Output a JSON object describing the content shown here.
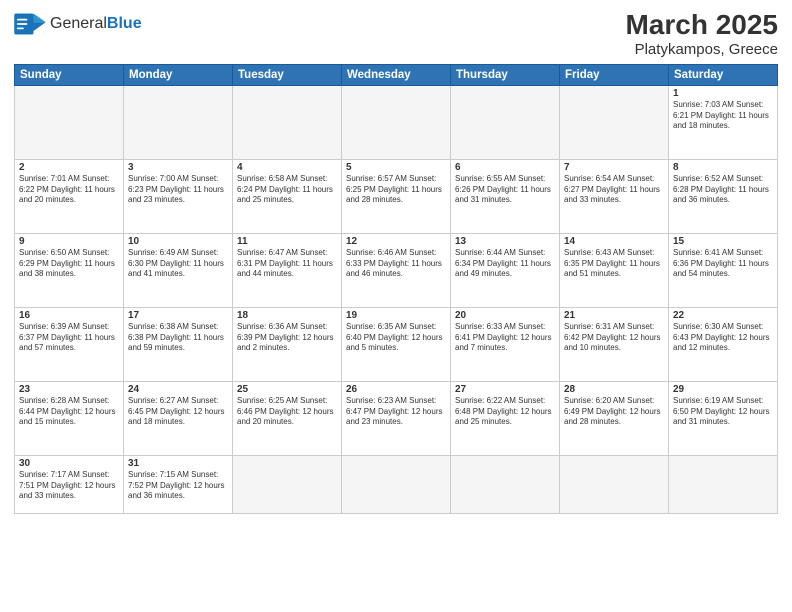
{
  "header": {
    "logo_text_normal": "General",
    "logo_text_bold": "Blue",
    "title": "March 2025",
    "subtitle": "Platykampos, Greece"
  },
  "days_of_week": [
    "Sunday",
    "Monday",
    "Tuesday",
    "Wednesday",
    "Thursday",
    "Friday",
    "Saturday"
  ],
  "weeks": [
    [
      {
        "day": "",
        "info": ""
      },
      {
        "day": "",
        "info": ""
      },
      {
        "day": "",
        "info": ""
      },
      {
        "day": "",
        "info": ""
      },
      {
        "day": "",
        "info": ""
      },
      {
        "day": "",
        "info": ""
      },
      {
        "day": "1",
        "info": "Sunrise: 7:03 AM\nSunset: 6:21 PM\nDaylight: 11 hours\nand 18 minutes."
      }
    ],
    [
      {
        "day": "2",
        "info": "Sunrise: 7:01 AM\nSunset: 6:22 PM\nDaylight: 11 hours\nand 20 minutes."
      },
      {
        "day": "3",
        "info": "Sunrise: 7:00 AM\nSunset: 6:23 PM\nDaylight: 11 hours\nand 23 minutes."
      },
      {
        "day": "4",
        "info": "Sunrise: 6:58 AM\nSunset: 6:24 PM\nDaylight: 11 hours\nand 25 minutes."
      },
      {
        "day": "5",
        "info": "Sunrise: 6:57 AM\nSunset: 6:25 PM\nDaylight: 11 hours\nand 28 minutes."
      },
      {
        "day": "6",
        "info": "Sunrise: 6:55 AM\nSunset: 6:26 PM\nDaylight: 11 hours\nand 31 minutes."
      },
      {
        "day": "7",
        "info": "Sunrise: 6:54 AM\nSunset: 6:27 PM\nDaylight: 11 hours\nand 33 minutes."
      },
      {
        "day": "8",
        "info": "Sunrise: 6:52 AM\nSunset: 6:28 PM\nDaylight: 11 hours\nand 36 minutes."
      }
    ],
    [
      {
        "day": "9",
        "info": "Sunrise: 6:50 AM\nSunset: 6:29 PM\nDaylight: 11 hours\nand 38 minutes."
      },
      {
        "day": "10",
        "info": "Sunrise: 6:49 AM\nSunset: 6:30 PM\nDaylight: 11 hours\nand 41 minutes."
      },
      {
        "day": "11",
        "info": "Sunrise: 6:47 AM\nSunset: 6:31 PM\nDaylight: 11 hours\nand 44 minutes."
      },
      {
        "day": "12",
        "info": "Sunrise: 6:46 AM\nSunset: 6:33 PM\nDaylight: 11 hours\nand 46 minutes."
      },
      {
        "day": "13",
        "info": "Sunrise: 6:44 AM\nSunset: 6:34 PM\nDaylight: 11 hours\nand 49 minutes."
      },
      {
        "day": "14",
        "info": "Sunrise: 6:43 AM\nSunset: 6:35 PM\nDaylight: 11 hours\nand 51 minutes."
      },
      {
        "day": "15",
        "info": "Sunrise: 6:41 AM\nSunset: 6:36 PM\nDaylight: 11 hours\nand 54 minutes."
      }
    ],
    [
      {
        "day": "16",
        "info": "Sunrise: 6:39 AM\nSunset: 6:37 PM\nDaylight: 11 hours\nand 57 minutes."
      },
      {
        "day": "17",
        "info": "Sunrise: 6:38 AM\nSunset: 6:38 PM\nDaylight: 11 hours\nand 59 minutes."
      },
      {
        "day": "18",
        "info": "Sunrise: 6:36 AM\nSunset: 6:39 PM\nDaylight: 12 hours\nand 2 minutes."
      },
      {
        "day": "19",
        "info": "Sunrise: 6:35 AM\nSunset: 6:40 PM\nDaylight: 12 hours\nand 5 minutes."
      },
      {
        "day": "20",
        "info": "Sunrise: 6:33 AM\nSunset: 6:41 PM\nDaylight: 12 hours\nand 7 minutes."
      },
      {
        "day": "21",
        "info": "Sunrise: 6:31 AM\nSunset: 6:42 PM\nDaylight: 12 hours\nand 10 minutes."
      },
      {
        "day": "22",
        "info": "Sunrise: 6:30 AM\nSunset: 6:43 PM\nDaylight: 12 hours\nand 12 minutes."
      }
    ],
    [
      {
        "day": "23",
        "info": "Sunrise: 6:28 AM\nSunset: 6:44 PM\nDaylight: 12 hours\nand 15 minutes."
      },
      {
        "day": "24",
        "info": "Sunrise: 6:27 AM\nSunset: 6:45 PM\nDaylight: 12 hours\nand 18 minutes."
      },
      {
        "day": "25",
        "info": "Sunrise: 6:25 AM\nSunset: 6:46 PM\nDaylight: 12 hours\nand 20 minutes."
      },
      {
        "day": "26",
        "info": "Sunrise: 6:23 AM\nSunset: 6:47 PM\nDaylight: 12 hours\nand 23 minutes."
      },
      {
        "day": "27",
        "info": "Sunrise: 6:22 AM\nSunset: 6:48 PM\nDaylight: 12 hours\nand 25 minutes."
      },
      {
        "day": "28",
        "info": "Sunrise: 6:20 AM\nSunset: 6:49 PM\nDaylight: 12 hours\nand 28 minutes."
      },
      {
        "day": "29",
        "info": "Sunrise: 6:19 AM\nSunset: 6:50 PM\nDaylight: 12 hours\nand 31 minutes."
      }
    ],
    [
      {
        "day": "30",
        "info": "Sunrise: 7:17 AM\nSunset: 7:51 PM\nDaylight: 12 hours\nand 33 minutes."
      },
      {
        "day": "31",
        "info": "Sunrise: 7:15 AM\nSunset: 7:52 PM\nDaylight: 12 hours\nand 36 minutes."
      },
      {
        "day": "",
        "info": ""
      },
      {
        "day": "",
        "info": ""
      },
      {
        "day": "",
        "info": ""
      },
      {
        "day": "",
        "info": ""
      },
      {
        "day": "",
        "info": ""
      }
    ]
  ]
}
